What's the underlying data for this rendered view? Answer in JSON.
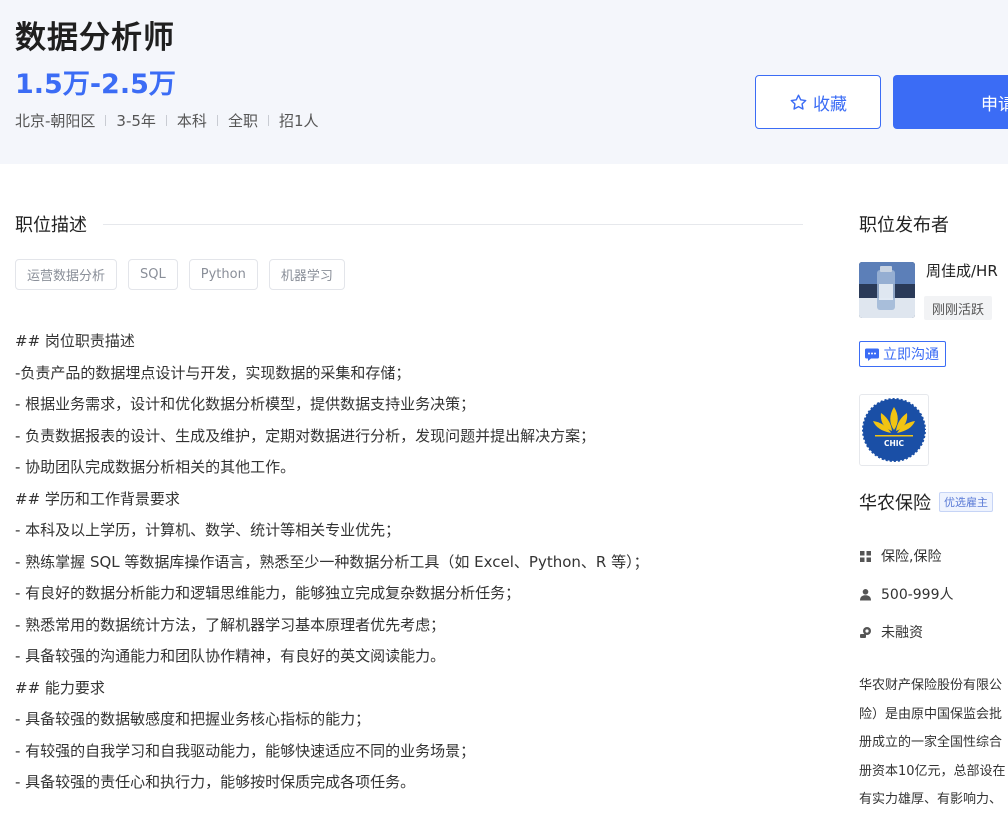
{
  "job": {
    "title": "数据分析师",
    "salary": "1.5万-2.5万",
    "meta": [
      "北京-朝阳区",
      "3-5年",
      "本科",
      "全职",
      "招1人"
    ]
  },
  "actions": {
    "collect_label": "收藏",
    "apply_label": "申请"
  },
  "description": {
    "section_title": "职位描述",
    "tags": [
      "运营数据分析",
      "SQL",
      "Python",
      "机器学习"
    ],
    "lines": [
      "## 岗位职责描述",
      "-负责产品的数据埋点设计与开发，实现数据的采集和存储；",
      "- 根据业务需求，设计和优化数据分析模型，提供数据支持业务决策；",
      "- 负责数据报表的设计、生成及维护，定期对数据进行分析，发现问题并提出解决方案；",
      "- 协助团队完成数据分析相关的其他工作。",
      "## 学历和工作背景要求",
      "- 本科及以上学历，计算机、数学、统计等相关专业优先；",
      "- 熟练掌握 SQL 等数据库操作语言，熟悉至少一种数据分析工具（如 Excel、Python、R 等）；",
      "- 有良好的数据分析能力和逻辑思维能力，能够独立完成复杂数据分析任务；",
      "- 熟悉常用的数据统计方法，了解机器学习基本原理者优先考虑；",
      "- 具备较强的沟通能力和团队协作精神，有良好的英文阅读能力。",
      "## 能力要求",
      "- 具备较强的数据敏感度和把握业务核心指标的能力；",
      "- 有较强的自我学习和自我驱动能力，能够快速适应不同的业务场景；",
      "- 具备较强的责任心和执行力，能够按时保质完成各项任务。"
    ]
  },
  "publisher": {
    "section_title": "职位发布者",
    "name": "周佳成/HR",
    "status": "刚刚活跃",
    "chat_label": "立即沟通"
  },
  "company": {
    "logo_text": "CHIC",
    "name": "华农保险",
    "badge": "优选雇主",
    "industry": "保险,保险",
    "size": "500-999人",
    "funding": "未融资",
    "intro_lines": [
      "华农财产保险股份有限公",
      "险）是由原中国保监会批",
      "册成立的一家全国性综合",
      "册资本10亿元，总部设在",
      "有实力雄厚、有影响力、"
    ]
  },
  "colors": {
    "accent": "#3b6cf5",
    "header_bg": "#f4f6fb",
    "logo_blue": "#1a4fa6",
    "logo_yellow": "#f2c412"
  }
}
